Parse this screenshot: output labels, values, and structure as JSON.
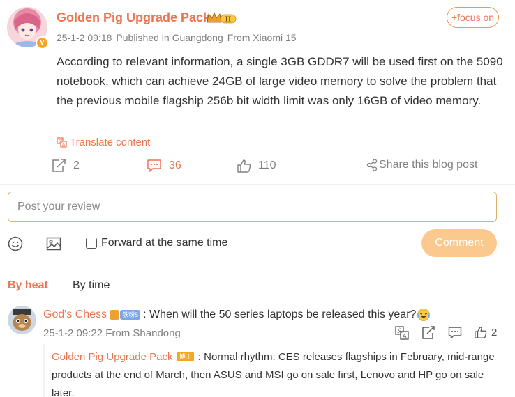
{
  "post": {
    "author": "Golden Pig Upgrade Pack",
    "author_level": "II",
    "date": "25-1-2 09:18",
    "location": "Published in Guangdong",
    "source": "From Xiaomi 15",
    "focus_label": "+focus on",
    "text": "According to relevant information, a single 3GB GDDR7 will be used first on the 5090 notebook, which can achieve 24GB of large video memory to solve the problem that the previous mobile flagship 256b bit width limit was only 16GB of video memory.",
    "translate_label": "Translate content"
  },
  "actions": {
    "repost_count": "2",
    "comment_count": "36",
    "like_count": "110",
    "share_label": "Share this blog post"
  },
  "composer": {
    "placeholder": "Post your review",
    "forward_label": "Forward at the same time",
    "submit_label": "Comment"
  },
  "sort": {
    "heat_label": "By heat",
    "time_label": "By time"
  },
  "comment": {
    "author": "God's Chess",
    "fan_badge": "铁粉5",
    "text": ": When will the 50 series laptops be released this year?",
    "date": "25-1-2 09:22",
    "location": "From Shandong",
    "like_count": "2",
    "reply": {
      "author": "Golden Pig Upgrade Pack",
      "badge": "博主",
      "text": ": Normal rhythm: CES releases flagships in February, mid-range products at the end of March, then ASUS and MSI go on sale first, Lenovo and HP go on sale later."
    }
  },
  "colors": {
    "accent": "#eb7350",
    "muted": "#808080",
    "button_bg": "#fbc88e"
  },
  "icons": [
    "verified-icon",
    "level-crown-icon",
    "translate-icon",
    "repost-icon",
    "comment-icon",
    "like-icon",
    "share-icon",
    "emoji-icon",
    "image-icon",
    "laugh-emoji-icon"
  ]
}
